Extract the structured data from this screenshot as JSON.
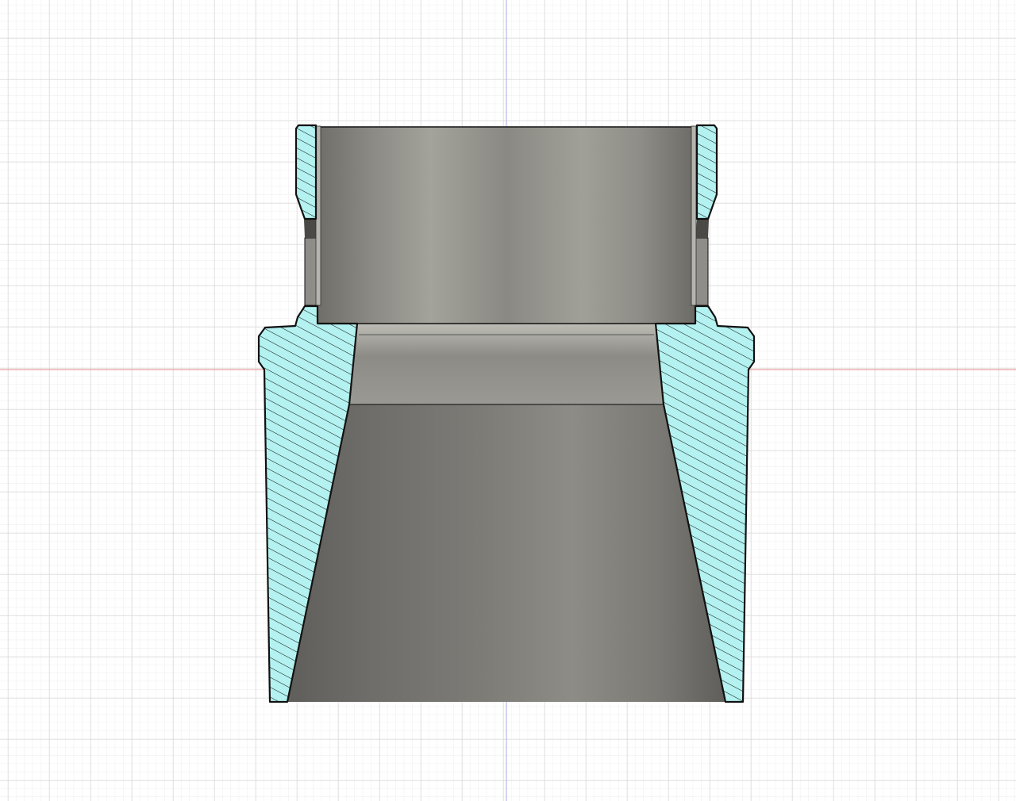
{
  "viewport": {
    "view": "section-analysis",
    "colors": {
      "background": "#ffffff",
      "grid_minor": "#ececec",
      "grid_major": "#d0d0d0",
      "axis_x": "#e88080",
      "axis_y": "#9a9ae0",
      "section_fill": "#b3f2f0",
      "hatch": "#1a1a1a",
      "body_light": "#a3a29b",
      "body_dark": "#6e6d68",
      "outline": "#111111"
    }
  }
}
